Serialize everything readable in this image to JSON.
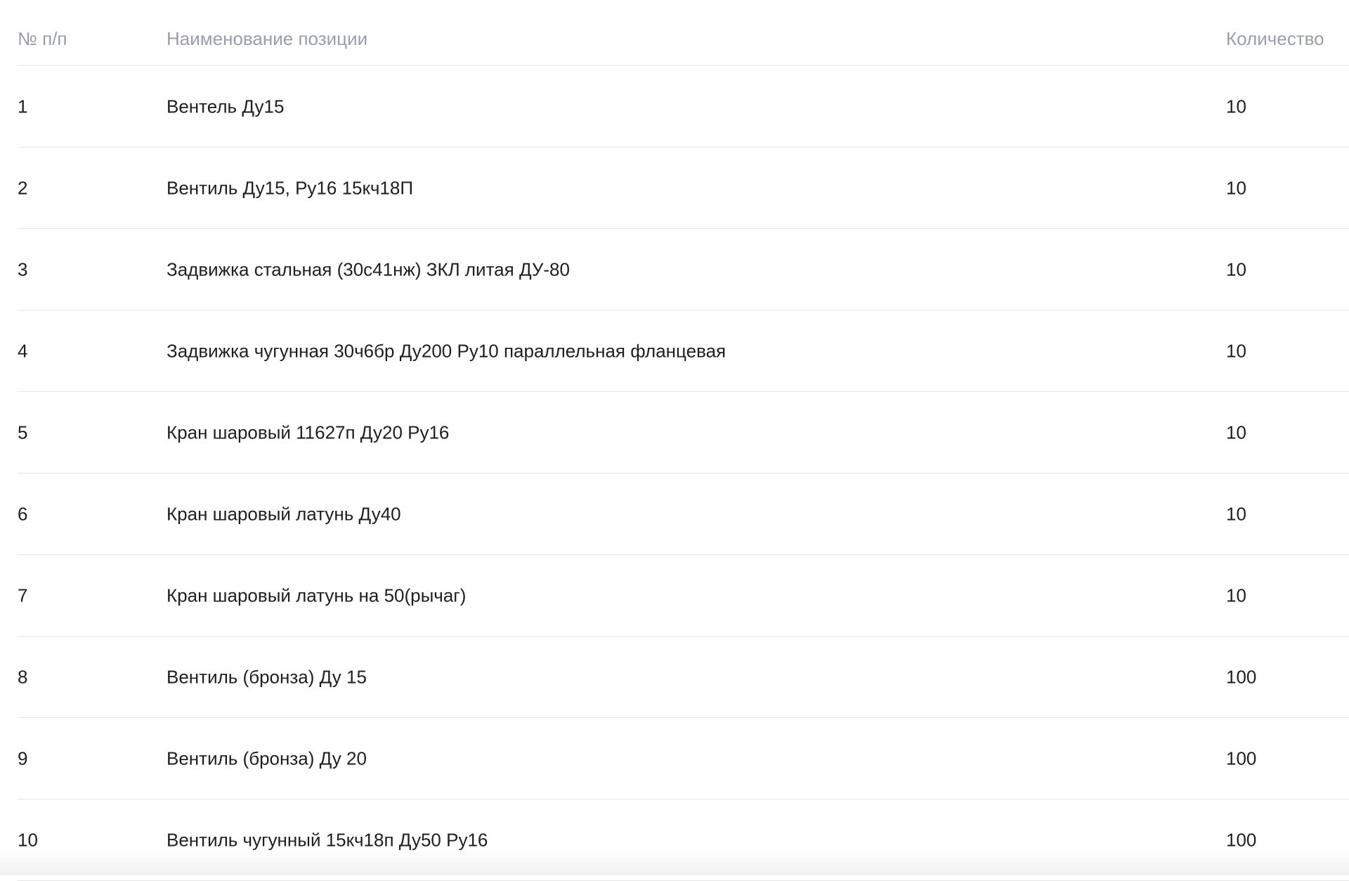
{
  "table": {
    "headers": {
      "number": "№ п/п",
      "name": "Наименование позиции",
      "quantity": "Количество"
    },
    "rows": [
      {
        "number": "1",
        "name": "Вентель Ду15",
        "quantity": "10"
      },
      {
        "number": "2",
        "name": "Вентиль Ду15, Ру16 15кч18П",
        "quantity": "10"
      },
      {
        "number": "3",
        "name": "Задвижка стальная (30с41нж) ЗКЛ литая ДУ-80",
        "quantity": "10"
      },
      {
        "number": "4",
        "name": "Задвижка чугунная 30ч6бр Ду200 Ру10 параллельная фланцевая",
        "quantity": "10"
      },
      {
        "number": "5",
        "name": "Кран шаровый 11627п Ду20 Ру16",
        "quantity": "10"
      },
      {
        "number": "6",
        "name": "Кран шаровый латунь Ду40",
        "quantity": "10"
      },
      {
        "number": "7",
        "name": "Кран шаровый латунь на 50(рычаг)",
        "quantity": "10"
      },
      {
        "number": "8",
        "name": "Вентиль (бронза) Ду 15",
        "quantity": "100"
      },
      {
        "number": "9",
        "name": "Вентиль (бронза) Ду 20",
        "quantity": "100"
      },
      {
        "number": "10",
        "name": "Вентиль чугунный 15кч18п Ду50 Ру16",
        "quantity": "100"
      }
    ]
  }
}
